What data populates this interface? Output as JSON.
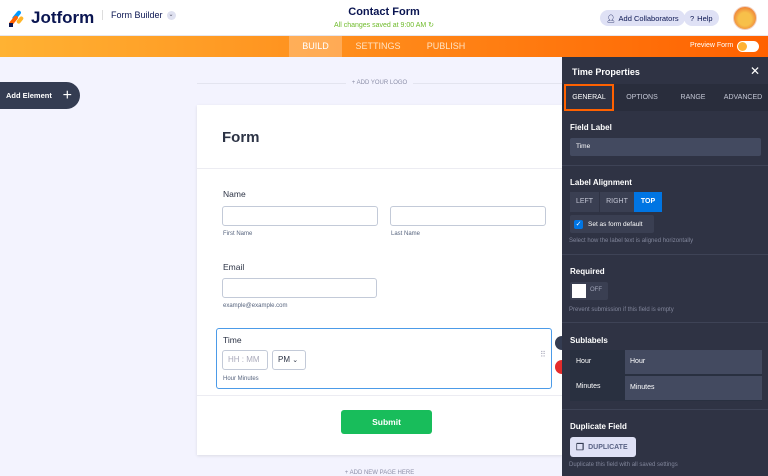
{
  "header": {
    "brand": "Jotform",
    "product": "Form Builder",
    "title": "Contact Form",
    "saved": "All changes saved at 9:00 AM",
    "add_collaborators": "Add Collaborators",
    "help": "Help"
  },
  "nav": {
    "tabs": [
      "BUILD",
      "SETTINGS",
      "PUBLISH"
    ],
    "active": "BUILD",
    "preview": "Preview Form"
  },
  "canvas": {
    "add_element": "Add Element",
    "add_logo": "+ ADD YOUR LOGO",
    "add_page": "+ ADD NEW PAGE HERE"
  },
  "form": {
    "title": "Form",
    "name": {
      "label": "Name",
      "first": "First Name",
      "last": "Last Name"
    },
    "email": {
      "label": "Email",
      "sublabel": "example@example.com"
    },
    "time": {
      "label": "Time",
      "placeholder": "HH : MM",
      "ampm": "PM",
      "sublabel": "Hour Minutes"
    },
    "submit": "Submit"
  },
  "panel": {
    "title": "Time Properties",
    "tabs": [
      "GENERAL",
      "OPTIONS",
      "RANGE",
      "ADVANCED"
    ],
    "field_label": {
      "heading": "Field Label",
      "value": "Time"
    },
    "alignment": {
      "heading": "Label Alignment",
      "options": [
        "LEFT",
        "RIGHT",
        "TOP"
      ],
      "selected": "TOP",
      "default_label": "Set as form default",
      "help": "Select how the label text is aligned horizontally"
    },
    "required": {
      "heading": "Required",
      "state": "OFF",
      "help": "Prevent submission if this field is empty"
    },
    "sublabels": {
      "heading": "Sublabels",
      "rows": [
        {
          "name": "Hour",
          "value": "Hour"
        },
        {
          "name": "Minutes",
          "value": "Minutes"
        }
      ]
    },
    "duplicate": {
      "heading": "Duplicate Field",
      "button": "DUPLICATE",
      "help": "Duplicate this field with all saved settings"
    }
  },
  "colors": {
    "accent": "#ff6100",
    "panel": "#2f3344",
    "submit": "#18bd5b",
    "active_option": "#0075e3"
  }
}
